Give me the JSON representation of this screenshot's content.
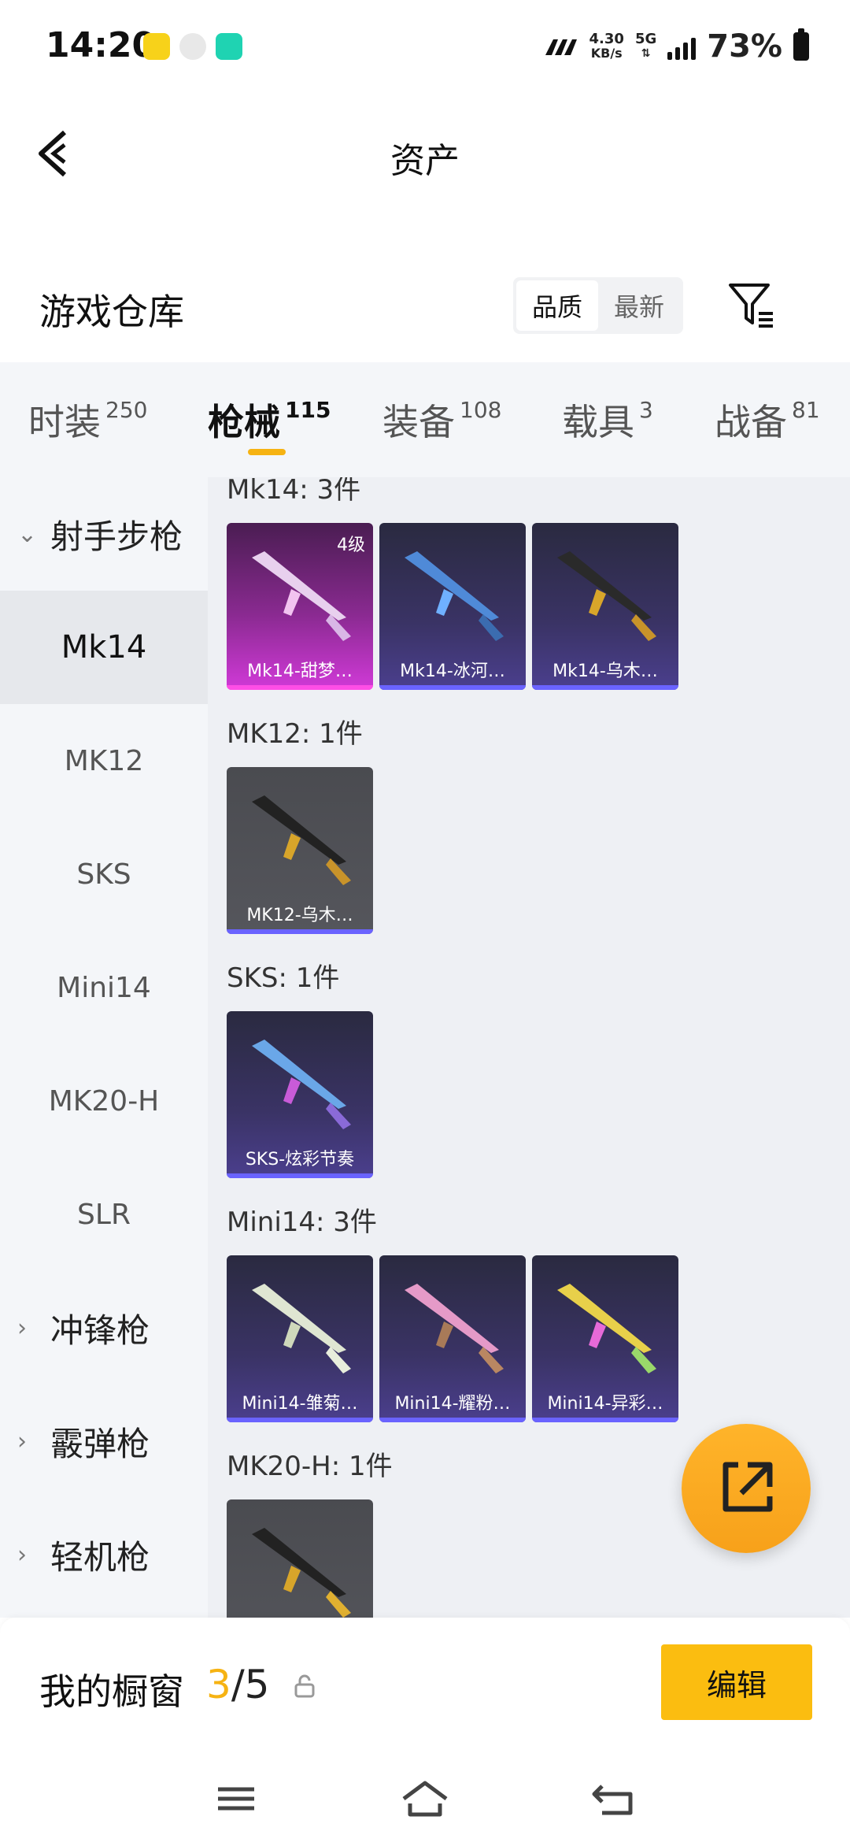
{
  "status_bar": {
    "time": "14:20",
    "net_speed": "4.30",
    "net_unit": "KB/s",
    "network": "5G",
    "battery": "73%"
  },
  "header": {
    "title": "资产"
  },
  "warehouse": {
    "title": "游戏仓库",
    "sort_options": [
      "品质",
      "最新"
    ]
  },
  "tabs": [
    {
      "label": "时装",
      "count": "250"
    },
    {
      "label": "枪械",
      "count": "115"
    },
    {
      "label": "装备",
      "count": "108"
    },
    {
      "label": "载具",
      "count": "3"
    },
    {
      "label": "战备",
      "count": "81"
    }
  ],
  "sidebar": {
    "group_open": "射手步枪",
    "items": [
      "Mk14",
      "MK12",
      "SKS",
      "Mini14",
      "MK20-H",
      "SLR"
    ],
    "groups_closed": [
      "冲锋枪",
      "霰弹枪",
      "轻机枪"
    ]
  },
  "groups": [
    {
      "label": "Mk14: 3件",
      "cards": [
        {
          "name": "Mk14-甜梦…",
          "level": "4级",
          "style": "pink"
        },
        {
          "name": "Mk14-冰河…",
          "style": "purple"
        },
        {
          "name": "Mk14-乌木…",
          "style": "purple"
        }
      ]
    },
    {
      "label": "MK12: 1件",
      "cards": [
        {
          "name": "MK12-乌木…",
          "style": "gray"
        }
      ]
    },
    {
      "label": "SKS: 1件",
      "cards": [
        {
          "name": "SKS-炫彩节奏",
          "style": "purple"
        }
      ]
    },
    {
      "label": "Mini14: 3件",
      "cards": [
        {
          "name": "Mini14-雏菊…",
          "style": "purple"
        },
        {
          "name": "Mini14-耀粉…",
          "style": "purple"
        },
        {
          "name": "Mini14-异彩…",
          "style": "purple"
        }
      ]
    },
    {
      "label": "MK20-H: 1件",
      "cards": [
        {
          "name": "",
          "style": "gray"
        }
      ]
    }
  ],
  "showcase": {
    "label": "我的橱窗",
    "current": "3",
    "total": "/5",
    "edit_label": "编辑"
  },
  "colors": {
    "accent": "#f6b313",
    "edit_button": "#fbbd10"
  }
}
